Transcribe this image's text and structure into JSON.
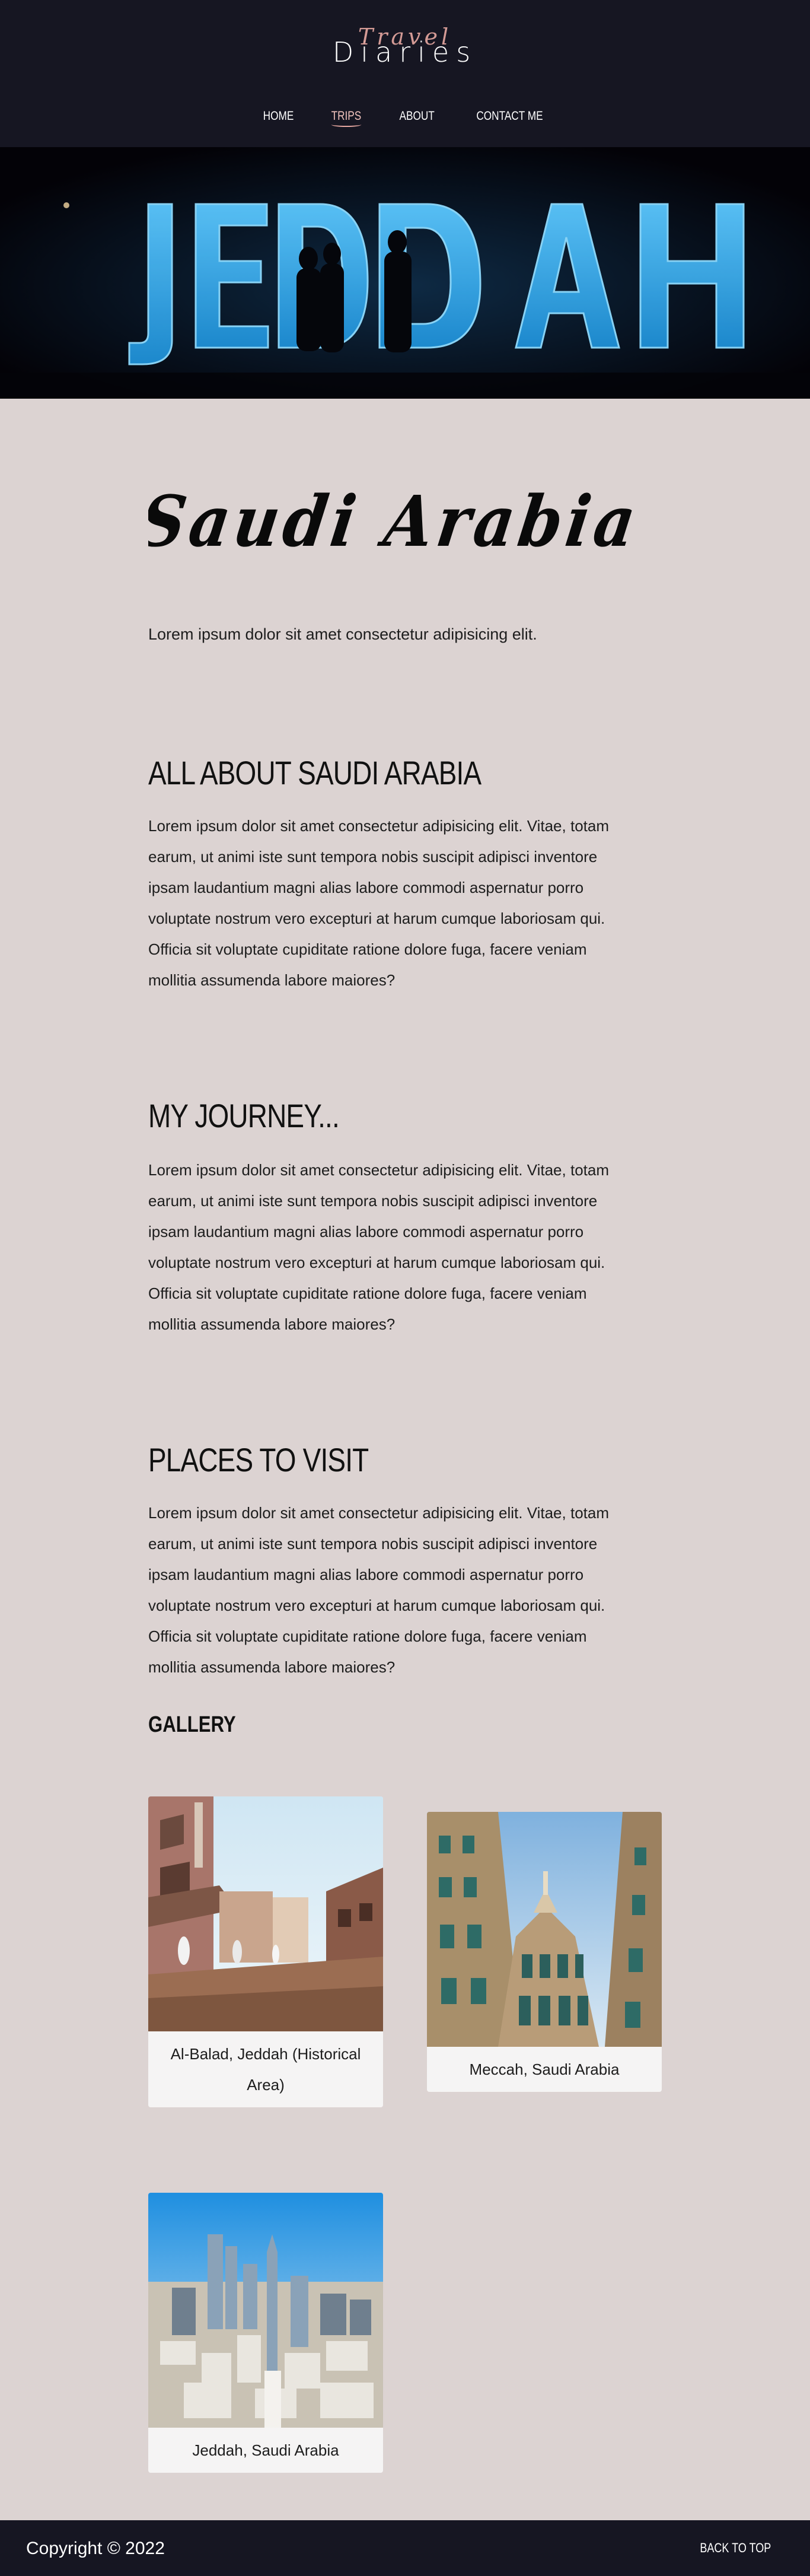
{
  "header": {
    "logo_script": "Travel",
    "logo_main": "Diaries",
    "nav": [
      {
        "label": "HOME"
      },
      {
        "label": "TRIPS",
        "active": true
      },
      {
        "label": "ABOUT"
      },
      {
        "label": "CONTACT ME"
      }
    ]
  },
  "hero": {
    "sign_text": "JEDDAH"
  },
  "page": {
    "title": "Saudi Arabia",
    "lead": "Lorem ipsum dolor sit amet consectetur adipisicing elit."
  },
  "sections": [
    {
      "heading": "ALL ABOUT SAUDI ARABIA",
      "lines": [
        "Lorem ipsum dolor sit amet consectetur adipisicing elit. Vitae, totam",
        "earum, ut animi iste sunt tempora nobis suscipit adipisci inventore",
        "ipsam laudantium magni alias labore commodi aspernatur porro",
        "voluptate nostrum vero excepturi at harum cumque laboriosam qui.",
        "Officia sit voluptate cupiditate ratione dolore fuga, facere veniam",
        "mollitia assumenda labore maiores?"
      ]
    },
    {
      "heading": "MY JOURNEY...",
      "lines": [
        "Lorem ipsum dolor sit amet consectetur adipisicing elit. Vitae, totam",
        "earum, ut animi iste sunt tempora nobis suscipit adipisci inventore",
        "ipsam laudantium magni alias labore commodi aspernatur porro",
        "voluptate nostrum vero excepturi at harum cumque laboriosam qui.",
        "Officia sit voluptate cupiditate ratione dolore fuga, facere veniam",
        "mollitia assumenda labore maiores?"
      ]
    },
    {
      "heading": "PLACES TO VISIT",
      "lines": [
        "Lorem ipsum dolor sit amet consectetur adipisicing elit. Vitae, totam",
        "earum, ut animi iste sunt tempora nobis suscipit adipisci inventore",
        "ipsam laudantium magni alias labore commodi aspernatur porro",
        "voluptate nostrum vero excepturi at harum cumque laboriosam qui.",
        "Officia sit voluptate cupiditate ratione dolore fuga, facere veniam",
        "mollitia assumenda labore maiores?"
      ]
    }
  ],
  "gallery": {
    "heading": "GALLERY",
    "items": [
      {
        "caption_line1": "Al-Balad, Jeddah (Historical",
        "caption_line2": "Area)"
      },
      {
        "caption_line1": "Meccah, Saudi Arabia"
      },
      {
        "caption_line1": "Jeddah, Saudi Arabia"
      }
    ]
  },
  "footer": {
    "copyright": "Copyright © 2022",
    "back_to_top": "BACK TO TOP"
  },
  "colors": {
    "header_bg": "#161622",
    "page_bg": "#dcd3d2",
    "accent": "#e8a9a2",
    "sign_blue": "#2aa7e8"
  }
}
